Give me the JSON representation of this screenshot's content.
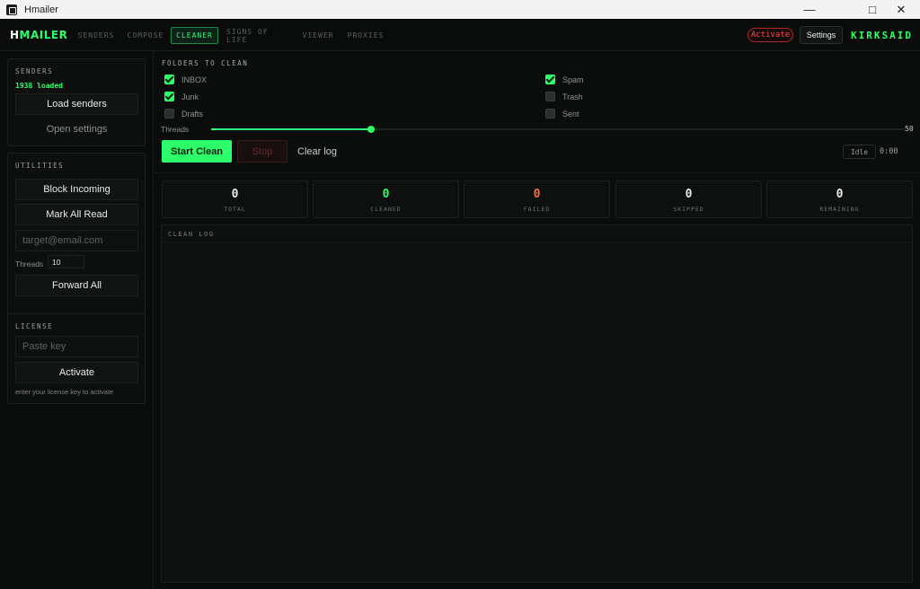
{
  "window": {
    "title": "Hmailer",
    "minimize_icon": "minimize-icon",
    "maximize_icon": "maximize-icon",
    "close_icon": "close-icon"
  },
  "nav": {
    "brand_part1": "H",
    "brand_part2": "MAILER",
    "tabs": [
      {
        "label": "SENDERS",
        "active": false
      },
      {
        "label": "COMPOSE",
        "active": false
      },
      {
        "label": "CLEANER",
        "active": true
      },
      {
        "label": "SIGNS OF LIFE",
        "active": false
      },
      {
        "label": "VIEWER",
        "active": false
      },
      {
        "label": "PROXIES",
        "active": false
      }
    ],
    "activate_label": "Activate",
    "settings_label": "Settings",
    "username": "KIRKSAID"
  },
  "sidebar": {
    "senders": {
      "title": "SENDERS",
      "loaded_text": "1938 loaded",
      "load_button": "Load senders",
      "settings_button": "Open settings"
    },
    "utilities": {
      "title": "UTILITIES",
      "block_button": "Block Incoming",
      "mark_read_button": "Mark All Read",
      "target_placeholder": "target@email.com",
      "threads_label": "Threads",
      "threads_value": "10",
      "forward_button": "Forward All"
    },
    "license": {
      "title": "LICENSE",
      "key_placeholder": "Paste key",
      "activate_button": "Activate",
      "hint": "enter your license key to activate"
    }
  },
  "cleaner": {
    "folders_title": "FOLDERS TO CLEAN",
    "folders": [
      {
        "label": "INBOX",
        "checked": true
      },
      {
        "label": "Spam",
        "checked": true
      },
      {
        "label": "Junk",
        "checked": true
      },
      {
        "label": "Trash",
        "checked": false
      },
      {
        "label": "Drafts",
        "checked": false
      },
      {
        "label": "Sent",
        "checked": false
      }
    ],
    "threads_label": "Threads",
    "threads_value": "50",
    "threads_fraction": 0.23,
    "start_button": "Start Clean",
    "stop_button": "Stop",
    "clear_button": "Clear log",
    "status": "Idle",
    "timer": "0:00",
    "stats": [
      {
        "value": "0",
        "label": "TOTAL",
        "color": "#e8ebe8"
      },
      {
        "value": "0",
        "label": "CLEANED",
        "color": "#2cff6a"
      },
      {
        "value": "0",
        "label": "FAILED",
        "color": "#ff6a3d"
      },
      {
        "value": "0",
        "label": "SKIPPED",
        "color": "#e8ebe8"
      },
      {
        "value": "0",
        "label": "REMAINING",
        "color": "#e8ebe8"
      }
    ],
    "log_title": "CLEAN LOG"
  },
  "colors": {
    "accent": "#2cff6a",
    "danger": "#ff4a4a",
    "background": "#0b0d0c"
  }
}
